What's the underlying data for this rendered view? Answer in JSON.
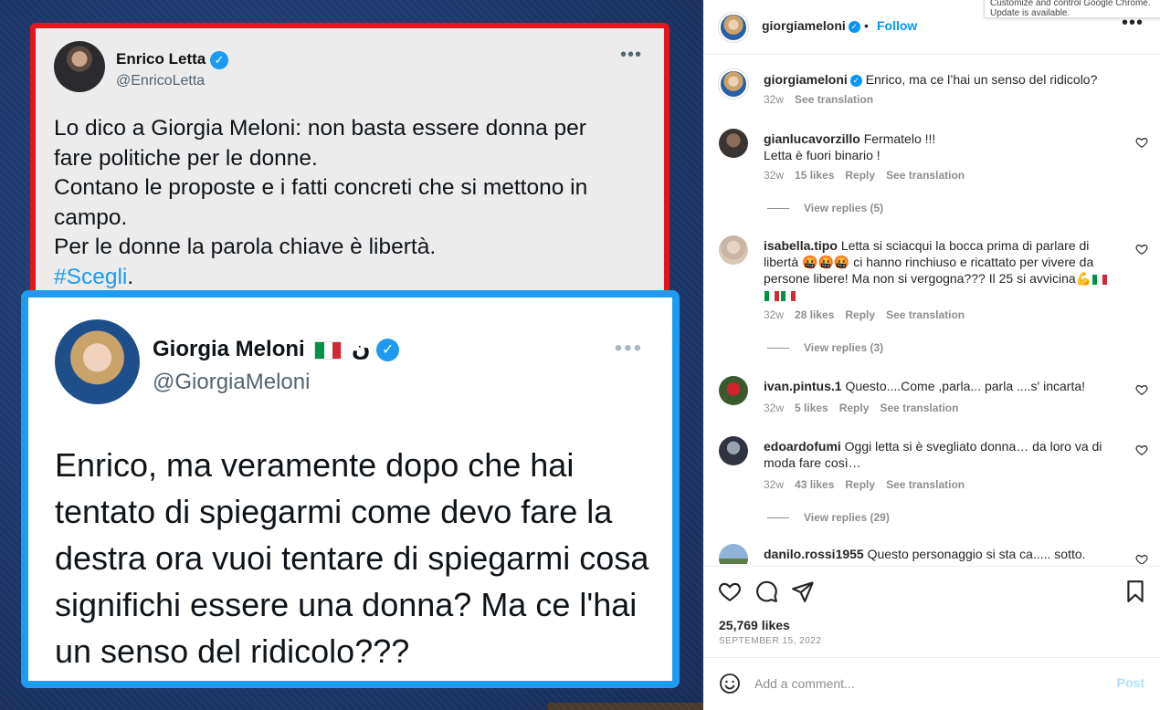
{
  "media": {
    "letta": {
      "name": "Enrico Letta",
      "handle": "@EnricoLetta",
      "more": "•••",
      "lines": [
        "Lo dico a Giorgia Meloni: non basta essere donna per",
        "fare politiche per le donne.",
        "Contano le proposte e i fatti concreti che si mettono in",
        "campo.",
        "Per le donne la parola chiave è libertà."
      ],
      "hashtag": "#Scegli",
      "hashtag_suffix": "."
    },
    "meloni": {
      "name": "Giorgia Meloni",
      "name_suffix": "ن",
      "handle": "@GiorgiaMeloni",
      "more": "•••",
      "text": "Enrico, ma veramente dopo che hai tentato di spiegarmi come devo fare la destra ora vuoi tentare di spiegarmi cosa significhi essere una donna? Ma ce l'hai un senso del ridicolo???"
    }
  },
  "tooltip": {
    "text": "Customize and control Google Chrome. Update is available."
  },
  "header": {
    "username": "giorgiameloni",
    "dot": "•",
    "follow": "Follow",
    "more": "•••"
  },
  "caption": {
    "username": "giorgiameloni",
    "text": "Enrico, ma ce l’hai un senso del ridicolo?",
    "time": "32w",
    "see_translation": "See translation"
  },
  "comments": [
    {
      "username": "gianlucavorzillo",
      "text": "Fermatelo !!!",
      "text2": "Letta è fuori binario !",
      "time": "32w",
      "likes": "15 likes",
      "reply": "Reply",
      "see_translation": "See translation",
      "view_replies": "View replies (5)"
    },
    {
      "username": "isabella.tipo",
      "text": "Letta si sciacqui la bocca prima di parlare di libertà 🤬🤬🤬 ci hanno rinchiuso e ricattato per vivere da persone libere! Ma non si vergogna??? Il 25 si avvicina💪",
      "time": "32w",
      "likes": "28 likes",
      "reply": "Reply",
      "see_translation": "See translation",
      "view_replies": "View replies (3)"
    },
    {
      "username": "ivan.pintus.1",
      "text": "Questo....Come ,parla... parla ....s' incarta!",
      "time": "32w",
      "likes": "5 likes",
      "reply": "Reply",
      "see_translation": "See translation"
    },
    {
      "username": "edoardofumi",
      "text": "Oggi letta si è svegliato donna… da loro va di moda fare così…",
      "time": "32w",
      "likes": "43 likes",
      "reply": "Reply",
      "see_translation": "See translation",
      "view_replies": "View replies (29)"
    },
    {
      "username": "danilo.rossi1955",
      "text": "Questo personaggio si sta ca..... sotto."
    }
  ],
  "post": {
    "likes": "25,769 likes",
    "date": "SEPTEMBER 15, 2022"
  },
  "add_comment": {
    "placeholder": "Add a comment...",
    "post": "Post"
  },
  "icons": {
    "heart": "heart-icon",
    "comment": "comment-icon",
    "share": "share-icon",
    "bookmark": "bookmark-icon",
    "emoji": "emoji-icon"
  },
  "colors": {
    "twitter_blue": "#1d9bf0",
    "red_border": "#e3161b",
    "instagram_blue": "#0095f6",
    "muted": "#8e8e8e"
  }
}
